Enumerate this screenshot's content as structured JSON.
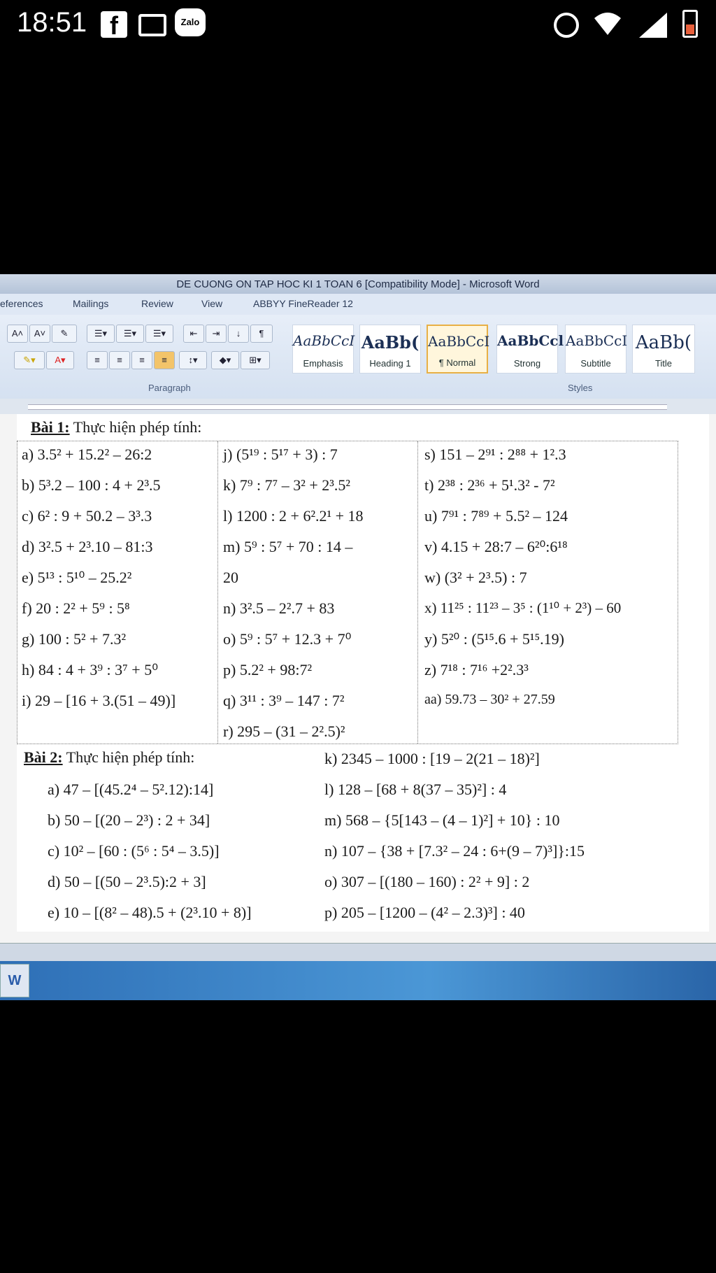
{
  "status_bar": {
    "time": "18:51",
    "facebook_glyph": "f",
    "zalo_label": "Zalo",
    "icons": [
      "facebook-icon",
      "gmail-icon",
      "zalo-icon",
      "alarm-icon",
      "wifi-icon",
      "signal-icon",
      "battery-icon"
    ]
  },
  "word": {
    "title": "DE CUONG ON TAP HOC KI 1 TOAN 6 [Compatibility Mode] - Microsoft Word",
    "tabs": [
      "eferences",
      "Mailings",
      "Review",
      "View",
      "ABBYY FineReader 12"
    ],
    "ribbon_groups": {
      "paragraph": "Paragraph",
      "styles": "Styles"
    },
    "styles": [
      {
        "sample": "AaBbCcI",
        "name": "Emphasis"
      },
      {
        "sample": "AaBb(",
        "name": "Heading 1"
      },
      {
        "sample": "AaBbCcI",
        "name": "¶ Normal"
      },
      {
        "sample": "AaBbCcl",
        "name": "Strong"
      },
      {
        "sample": "AaBbCcI",
        "name": "Subtitle"
      },
      {
        "sample": "AaBb(",
        "name": "Title"
      }
    ]
  },
  "doc": {
    "bai1_heading": "Bài 1:",
    "bai1_text": " Thực hiện phép tính:",
    "bai1_col1": [
      "a) 3.5² + 15.2² – 26:2",
      "b) 5³.2 – 100 : 4 + 2³.5",
      "c) 6² : 9 + 50.2 – 3³.3",
      "d) 3².5 + 2³.10 – 81:3",
      "e) 5¹³ : 5¹⁰ – 25.2²",
      "f) 20 : 2² + 5⁹ : 5⁸",
      "g) 100 : 5² + 7.3²",
      "h) 84 : 4 + 3⁹ : 3⁷ + 5⁰",
      "i) 29 – [16 + 3.(51 – 49)]"
    ],
    "bai1_col2": [
      "j) (5¹⁹ : 5¹⁷ + 3) : 7",
      "k) 7⁹ : 7⁷ – 3² + 2³.5²",
      "l) 1200 : 2 + 6².2¹ + 18",
      "m)     5⁹ : 5⁷ + 70 : 14 –",
      "    20",
      "n) 3².5 – 2².7 + 83",
      "o) 5⁹ : 5⁷ + 12.3 + 7⁰",
      "p) 5.2² + 98:7²",
      "q) 3¹¹ : 3⁹ – 147 : 7²",
      "r) 295 – (31 – 2².5)²"
    ],
    "bai1_col3": [
      "s) 151 – 2⁹¹ : 2⁸⁸ + 1².3",
      "t) 2³⁸ : 2³⁶ + 5¹.3² - 7²",
      "u) 7⁹¹ : 7⁸⁹ + 5.5² – 124",
      "v) 4.15 + 28:7 – 6²⁰:6¹⁸",
      "w)     (3² + 2³.5) : 7",
      "x) 11²⁵ : 11²³ – 3⁵ : (1¹⁰ + 2³) – 60",
      "y) 5²⁰ : (5¹⁵.6 + 5¹⁵.19)",
      "z) 7¹⁸ : 7¹⁶ +2².3³",
      "aa)      59.73 – 30² + 27.59"
    ],
    "bai2_heading": "Bài 2:",
    "bai2_text": " Thực hiện phép tính:",
    "bai2_left": [
      "a)  47 – [(45.2⁴ – 5².12):14]",
      "b)  50 – [(20 – 2³) : 2 + 34]",
      "c)  10² – [60 : (5⁶ : 5⁴ – 3.5)]",
      "d)  50 – [(50 – 2³.5):2 + 3]",
      "e)  10 – [(8² – 48).5 + (2³.10 + 8)]"
    ],
    "bai2_right": [
      "k)  2345 – 1000 : [19 – 2(21 – 18)²]",
      "l)  128 – [68 + 8(37 – 35)²] : 4",
      "m) 568 – {5[143 – (4 – 1)²] + 10} : 10",
      "n)  107 – {38 + [7.3² – 24 : 6+(9 – 7)³]}:15",
      "o)  307 – [(180 – 160) : 2² + 9] : 2",
      "p)  205 – [1200 – (4² – 2.3)³] : 40"
    ]
  }
}
